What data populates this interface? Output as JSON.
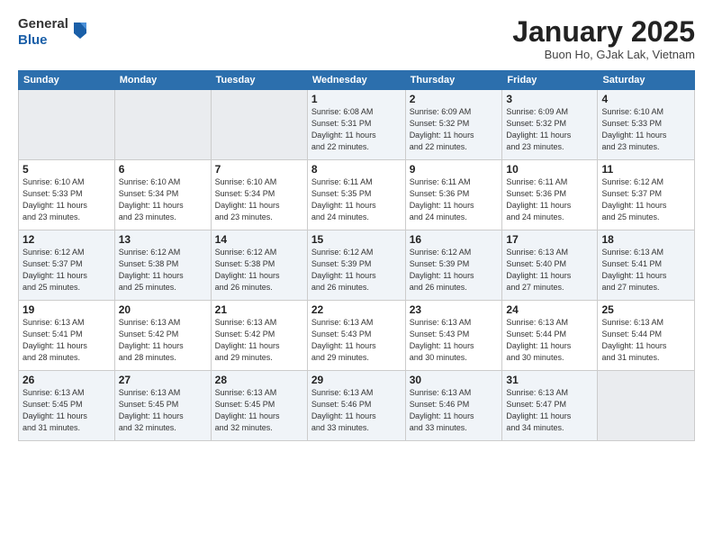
{
  "header": {
    "logo_general": "General",
    "logo_blue": "Blue",
    "month_title": "January 2025",
    "location": "Buon Ho, GJak Lak, Vietnam"
  },
  "days_of_week": [
    "Sunday",
    "Monday",
    "Tuesday",
    "Wednesday",
    "Thursday",
    "Friday",
    "Saturday"
  ],
  "weeks": [
    [
      {
        "num": "",
        "info": ""
      },
      {
        "num": "",
        "info": ""
      },
      {
        "num": "",
        "info": ""
      },
      {
        "num": "1",
        "info": "Sunrise: 6:08 AM\nSunset: 5:31 PM\nDaylight: 11 hours\nand 22 minutes."
      },
      {
        "num": "2",
        "info": "Sunrise: 6:09 AM\nSunset: 5:32 PM\nDaylight: 11 hours\nand 22 minutes."
      },
      {
        "num": "3",
        "info": "Sunrise: 6:09 AM\nSunset: 5:32 PM\nDaylight: 11 hours\nand 23 minutes."
      },
      {
        "num": "4",
        "info": "Sunrise: 6:10 AM\nSunset: 5:33 PM\nDaylight: 11 hours\nand 23 minutes."
      }
    ],
    [
      {
        "num": "5",
        "info": "Sunrise: 6:10 AM\nSunset: 5:33 PM\nDaylight: 11 hours\nand 23 minutes."
      },
      {
        "num": "6",
        "info": "Sunrise: 6:10 AM\nSunset: 5:34 PM\nDaylight: 11 hours\nand 23 minutes."
      },
      {
        "num": "7",
        "info": "Sunrise: 6:10 AM\nSunset: 5:34 PM\nDaylight: 11 hours\nand 23 minutes."
      },
      {
        "num": "8",
        "info": "Sunrise: 6:11 AM\nSunset: 5:35 PM\nDaylight: 11 hours\nand 24 minutes."
      },
      {
        "num": "9",
        "info": "Sunrise: 6:11 AM\nSunset: 5:36 PM\nDaylight: 11 hours\nand 24 minutes."
      },
      {
        "num": "10",
        "info": "Sunrise: 6:11 AM\nSunset: 5:36 PM\nDaylight: 11 hours\nand 24 minutes."
      },
      {
        "num": "11",
        "info": "Sunrise: 6:12 AM\nSunset: 5:37 PM\nDaylight: 11 hours\nand 25 minutes."
      }
    ],
    [
      {
        "num": "12",
        "info": "Sunrise: 6:12 AM\nSunset: 5:37 PM\nDaylight: 11 hours\nand 25 minutes."
      },
      {
        "num": "13",
        "info": "Sunrise: 6:12 AM\nSunset: 5:38 PM\nDaylight: 11 hours\nand 25 minutes."
      },
      {
        "num": "14",
        "info": "Sunrise: 6:12 AM\nSunset: 5:38 PM\nDaylight: 11 hours\nand 26 minutes."
      },
      {
        "num": "15",
        "info": "Sunrise: 6:12 AM\nSunset: 5:39 PM\nDaylight: 11 hours\nand 26 minutes."
      },
      {
        "num": "16",
        "info": "Sunrise: 6:12 AM\nSunset: 5:39 PM\nDaylight: 11 hours\nand 26 minutes."
      },
      {
        "num": "17",
        "info": "Sunrise: 6:13 AM\nSunset: 5:40 PM\nDaylight: 11 hours\nand 27 minutes."
      },
      {
        "num": "18",
        "info": "Sunrise: 6:13 AM\nSunset: 5:41 PM\nDaylight: 11 hours\nand 27 minutes."
      }
    ],
    [
      {
        "num": "19",
        "info": "Sunrise: 6:13 AM\nSunset: 5:41 PM\nDaylight: 11 hours\nand 28 minutes."
      },
      {
        "num": "20",
        "info": "Sunrise: 6:13 AM\nSunset: 5:42 PM\nDaylight: 11 hours\nand 28 minutes."
      },
      {
        "num": "21",
        "info": "Sunrise: 6:13 AM\nSunset: 5:42 PM\nDaylight: 11 hours\nand 29 minutes."
      },
      {
        "num": "22",
        "info": "Sunrise: 6:13 AM\nSunset: 5:43 PM\nDaylight: 11 hours\nand 29 minutes."
      },
      {
        "num": "23",
        "info": "Sunrise: 6:13 AM\nSunset: 5:43 PM\nDaylight: 11 hours\nand 30 minutes."
      },
      {
        "num": "24",
        "info": "Sunrise: 6:13 AM\nSunset: 5:44 PM\nDaylight: 11 hours\nand 30 minutes."
      },
      {
        "num": "25",
        "info": "Sunrise: 6:13 AM\nSunset: 5:44 PM\nDaylight: 11 hours\nand 31 minutes."
      }
    ],
    [
      {
        "num": "26",
        "info": "Sunrise: 6:13 AM\nSunset: 5:45 PM\nDaylight: 11 hours\nand 31 minutes."
      },
      {
        "num": "27",
        "info": "Sunrise: 6:13 AM\nSunset: 5:45 PM\nDaylight: 11 hours\nand 32 minutes."
      },
      {
        "num": "28",
        "info": "Sunrise: 6:13 AM\nSunset: 5:45 PM\nDaylight: 11 hours\nand 32 minutes."
      },
      {
        "num": "29",
        "info": "Sunrise: 6:13 AM\nSunset: 5:46 PM\nDaylight: 11 hours\nand 33 minutes."
      },
      {
        "num": "30",
        "info": "Sunrise: 6:13 AM\nSunset: 5:46 PM\nDaylight: 11 hours\nand 33 minutes."
      },
      {
        "num": "31",
        "info": "Sunrise: 6:13 AM\nSunset: 5:47 PM\nDaylight: 11 hours\nand 34 minutes."
      },
      {
        "num": "",
        "info": ""
      }
    ]
  ]
}
